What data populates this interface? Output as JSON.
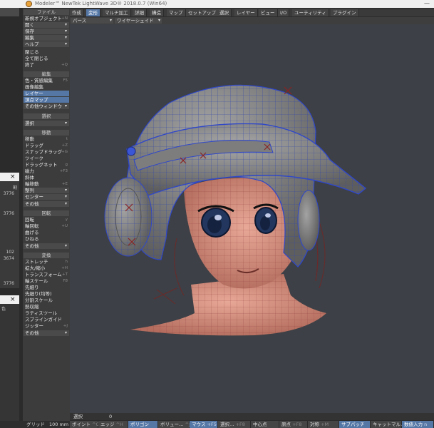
{
  "window": {
    "title": "Modeler™ NewTek LightWave 3D® 2018.0.7 (Win64)",
    "minimize_glyph": "—"
  },
  "background_windows": {
    "close_glyph": "×",
    "values": [
      "3776",
      "3776",
      "102",
      "3674",
      "3776"
    ],
    "field_label": "割",
    "label_2": "色"
  },
  "toolpanel": {
    "file": {
      "header": "ファイル",
      "new_object": "新規オブジェクト",
      "new_object_shortcut": "+N",
      "open": "開く",
      "save": "保存",
      "edit": "編集",
      "help": "ヘルプ",
      "close": "閉じる",
      "close_all": "全て閉じる",
      "quit": "終了",
      "quit_shortcut": "+Q"
    },
    "edit": {
      "header": "編集",
      "color_texture": "色・質感編集",
      "color_texture_shortcut": "F5",
      "image_edit": "画像編集",
      "layer": "レイヤー",
      "vertex_map": "頂点マップ",
      "other_window": "その他ウィンドウ"
    },
    "select": {
      "header": "選択",
      "select": "選択"
    },
    "move": {
      "header": "移動",
      "move": "移動",
      "move_shortcut": "t",
      "drag": "ドラッグ",
      "drag_shortcut": "+Z",
      "snap_drag": "スナップドラッグ",
      "snap_drag_shortcut": "+G",
      "tweak": "ツイーク",
      "drag_net": "ドラッグネット",
      "drag_net_shortcut": "g",
      "magnet": "磁力",
      "magnet_shortcut": "+F3",
      "jitter": "斜体",
      "axis_move": "軸移動",
      "axis_move_shortcut": "+E",
      "align": "整列",
      "center": "センター",
      "center_shortcut": "F2",
      "other": "その他"
    },
    "rotate": {
      "header": "回転",
      "rotate": "回転",
      "rotate_shortcut": "y",
      "axis_rotate": "軸回転",
      "axis_rotate_shortcut": "+U",
      "bend": "曲げる",
      "twist": "ひねる",
      "other": "その他"
    },
    "transform": {
      "header": "変換",
      "stretch": "ストレッチ",
      "stretch_shortcut": "h",
      "scale": "拡大/縮小",
      "scale_shortcut": "+H",
      "transform": "トランスフォーム",
      "transform_shortcut": "+T",
      "axis_scale": "軸スケール",
      "axis_scale_shortcut": "F8",
      "taper": "先細り",
      "taper_const": "先細り(均等)",
      "segment_scale": "分割スケール",
      "heat_shrink": "熱収縮",
      "lattice": "ラティスツール",
      "spline_guide": "スプラインガイド",
      "jitter": "ジッター",
      "jitter_shortcut": "+J",
      "other": "その他"
    }
  },
  "menubar": {
    "tabs": [
      "作成",
      "変形",
      "マルチ加工",
      "詳細",
      "構造",
      "マップ",
      "セットアップ",
      "選択",
      "レイヤー",
      "ビュー",
      "I/O",
      "ユーティリティ",
      "プラグイン"
    ],
    "active_index": 1
  },
  "viewport": {
    "view": "パース",
    "shading": "ワイヤーシェイド"
  },
  "status": {
    "label": "選択",
    "value": "0"
  },
  "bottombar": {
    "grid_label": "グリッド",
    "grid_value": "100 mm",
    "point": "ポイント",
    "point_sc": "^G",
    "edge": "エッジ",
    "edge_sc": "^H",
    "polygon": "ポリゴン",
    "volume": "ボリュー…",
    "volume_sc": "^J",
    "mouse": "マウス",
    "mouse_sc": "+F5",
    "select": "選択…",
    "select_sc": "+F8",
    "center": "中心点",
    "origin": "原点",
    "origin_sc": "+F8",
    "symmetry": "対称",
    "symmetry_sc": "+M",
    "subpatch": "サブパッチ",
    "catmull": "キャットマル…",
    "numeric": "数値入力",
    "numeric_sc": "n"
  },
  "colors": {
    "accent": "#5577a6",
    "panel": "#3c3c3c",
    "viewport": "#3d4046",
    "skin": "#d69282",
    "helmet": "#858585"
  }
}
